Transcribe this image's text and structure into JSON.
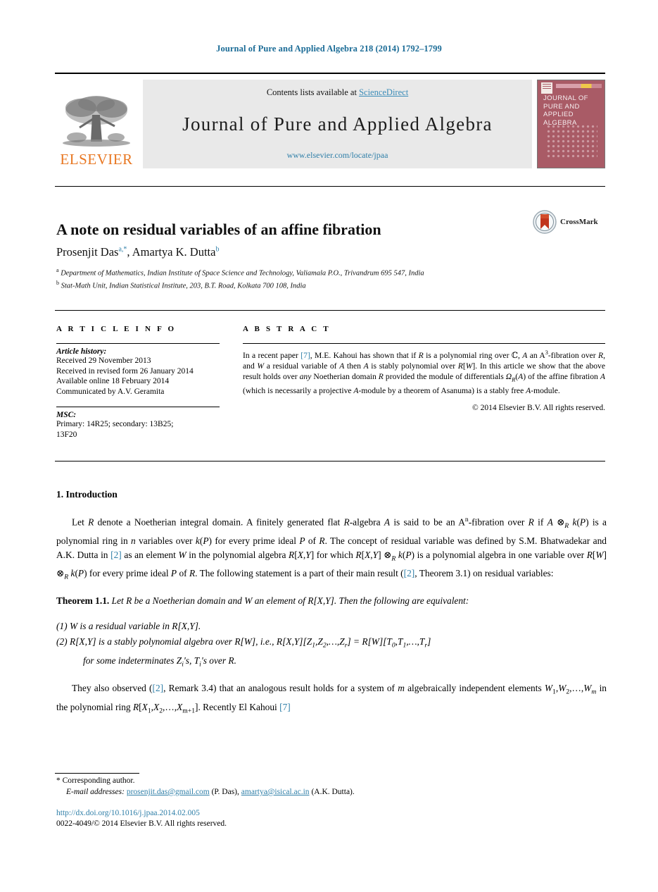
{
  "running_head": "Journal of Pure and Applied Algebra 218 (2014) 1792–1799",
  "masthead": {
    "publisher_name": "ELSEVIER",
    "contents_prefix": "Contents lists available at ",
    "contents_link": "ScienceDirect",
    "journal_name": "Journal of Pure and Applied Algebra",
    "journal_url": "www.elsevier.com/locate/jpaa",
    "cover_title": "JOURNAL OF PURE AND APPLIED ALGEBRA",
    "link_color": "#3b8cb8",
    "brand_color": "#E87722",
    "cover_color": "#a95b66"
  },
  "article": {
    "title": "A note on residual variables of an affine fibration",
    "crossmark_label": "CrossMark",
    "authors_html": "Prosenjit Das <sup>a,*</sup>, Amartya K. Dutta <sup>b</sup>",
    "affiliation_a": "Department of Mathematics, Indian Institute of Space Science and Technology, Valiamala P.O., Trivandrum 695 547, India",
    "affiliation_b": "Stat-Math Unit, Indian Statistical Institute, 203, B.T. Road, Kolkata 700 108, India"
  },
  "info": {
    "heading": "A R T I C L E    I N F O",
    "history_title": "Article history:",
    "history": [
      "Received 29 November 2013",
      "Received in revised form 26 January 2014",
      "Available online 18 February 2014",
      "Communicated by A.V. Geramita"
    ],
    "msc_title": "MSC:",
    "msc_line1": "Primary: 14R25; secondary: 13B25;",
    "msc_line2": "13F20"
  },
  "abstract": {
    "heading": "A B S T R A C T",
    "copyright": "© 2014 Elsevier B.V. All rights reserved."
  },
  "body": {
    "section_title": "1. Introduction",
    "theorem_label": "Theorem 1.1.",
    "list_marker_1": "(1)",
    "list_marker_2": "(2)"
  },
  "footer": {
    "corresponding": "* Corresponding author.",
    "email_label": "E-mail addresses:",
    "email_1": "prosenjit.das@gmail.com",
    "email_1_owner": "(P. Das),",
    "email_2": "amartya@isical.ac.in",
    "email_2_owner": "(A.K. Dutta).",
    "doi": "http://dx.doi.org/10.1016/j.jpaa.2014.02.005",
    "issn_line": "0022-4049/© 2014 Elsevier B.V. All rights reserved."
  }
}
